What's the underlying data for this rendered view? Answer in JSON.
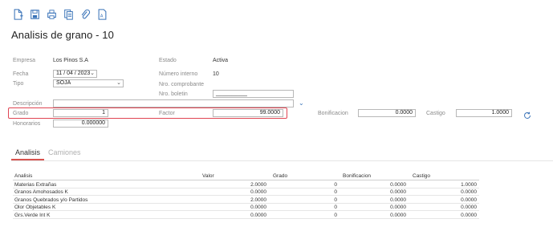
{
  "toolbar": {
    "icons": [
      "new-document-icon",
      "save-icon",
      "print-icon",
      "copy-document-icon",
      "attach-icon",
      "pdf-icon"
    ]
  },
  "page": {
    "title": "Analisis de grano - 10"
  },
  "form": {
    "empresa": {
      "label": "Empresa",
      "value": "Los Pinos S.A"
    },
    "estado": {
      "label": "Estado",
      "value": "Activa"
    },
    "fecha": {
      "label": "Fecha",
      "value": "11 / 04 /  2023"
    },
    "numero_interno": {
      "label": "Número interno",
      "value": "10"
    },
    "tipo": {
      "label": "Tipo",
      "value": "SOJA"
    },
    "nro_comprobante": {
      "label": "Nro. comprobante"
    },
    "nro_boletin": {
      "label": "Nro. boletin",
      "value": "__________"
    },
    "descripcion": {
      "label": "Descripción",
      "value": ""
    },
    "grado": {
      "label": "Grado",
      "value": "1"
    },
    "factor": {
      "label": "Factor",
      "value": "99.0000"
    },
    "bonificacion": {
      "label": "Bonificacion",
      "value": "0.0000"
    },
    "castigo": {
      "label": "Castigo",
      "value": "1.0000"
    },
    "honorarios": {
      "label": "Honorarios",
      "value": "0.000000"
    }
  },
  "tabs": [
    {
      "label": "Analisis",
      "active": true
    },
    {
      "label": "Camiones",
      "active": false
    }
  ],
  "table": {
    "headers": [
      "Analisis",
      "Valor",
      "Grado",
      "Bonificacion",
      "Castigo"
    ],
    "rows": [
      [
        "Materias Extrañas",
        "2.0000",
        "0",
        "0.0000",
        "1.0000"
      ],
      [
        "Granos Amohosados K",
        "0.0000",
        "0",
        "0.0000",
        "0.0000"
      ],
      [
        "Granos Quebrados y/o Partidos",
        "2.0000",
        "0",
        "0.0000",
        "0.0000"
      ],
      [
        "Olor Objetables K",
        "0.0000",
        "0",
        "0.0000",
        "0.0000"
      ],
      [
        "Grs.Verde Int K",
        "0.0000",
        "0",
        "0.0000",
        "0.0000"
      ]
    ]
  },
  "colors": {
    "accent": "#3a73b8",
    "highlight": "#e04553",
    "tab_underline": "#d9534f"
  }
}
